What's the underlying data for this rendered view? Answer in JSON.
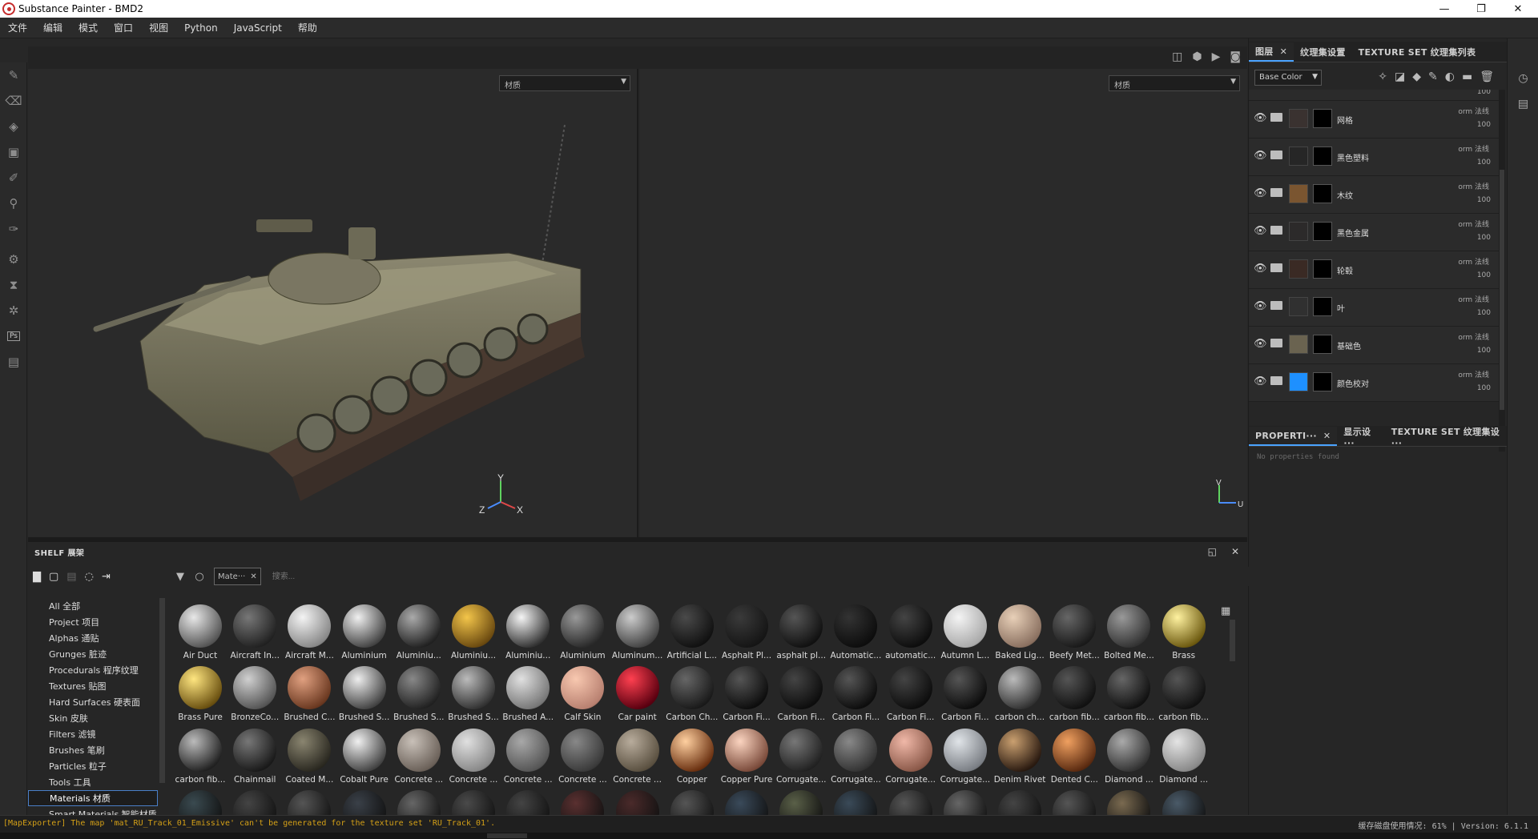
{
  "window": {
    "title": "Substance Painter - BMD2"
  },
  "menu": [
    "文件",
    "编辑",
    "模式",
    "窗口",
    "视图",
    "Python",
    "JavaScript",
    "帮助"
  ],
  "viewport": {
    "left_select": "材质",
    "right_select": "材质",
    "axis3d": {
      "x": "X",
      "y": "Y",
      "z": "Z"
    },
    "axis2d": {
      "v": "V",
      "u": "U"
    }
  },
  "right_panel": {
    "tabs_top": [
      {
        "label": "图层",
        "active": true,
        "closable": true
      },
      {
        "label": "纹理集设置",
        "active": false
      },
      {
        "label": "TEXTURE SET 纹理集列表",
        "active": false
      }
    ],
    "channel_select": "Base Color",
    "layers": [
      {
        "name": "网格",
        "blend": "orm 法线",
        "opacity": "100",
        "thumb": "#3a3230"
      },
      {
        "name": "黑色塑料",
        "blend": "orm 法线",
        "opacity": "100",
        "thumb": "#262626"
      },
      {
        "name": "木纹",
        "blend": "orm 法线",
        "opacity": "100",
        "thumb": "#7a5530"
      },
      {
        "name": "黑色金属",
        "blend": "orm 法线",
        "opacity": "100",
        "thumb": "#2c2a2a"
      },
      {
        "name": "轮毂",
        "blend": "orm 法线",
        "opacity": "100",
        "thumb": "#3a2a24"
      },
      {
        "name": "叶",
        "blend": "orm 法线",
        "opacity": "100",
        "thumb": "#303030"
      },
      {
        "name": "基础色",
        "blend": "orm 法线",
        "opacity": "100",
        "thumb": "#6a6350"
      },
      {
        "name": "颜色校对",
        "blend": "orm 法线",
        "opacity": "100",
        "thumb": "#1e90ff"
      }
    ],
    "partial_layer": {
      "name": "",
      "opacity": "100"
    },
    "tabs_bottom": [
      {
        "label": "PROPERTI···",
        "active": true,
        "closable": true
      },
      {
        "label": "显示设···",
        "active": false
      },
      {
        "label": "TEXTURE SET 纹理集设···",
        "active": false
      }
    ],
    "no_props": "No properties found"
  },
  "shelf": {
    "title": "SHELF 展架",
    "filter_chip": "Mate···",
    "search_placeholder": "搜索...",
    "categories": [
      {
        "label": "All 全部",
        "selected": false
      },
      {
        "label": "Project 项目",
        "selected": false
      },
      {
        "label": "Alphas 通贴",
        "selected": false
      },
      {
        "label": "Grunges 脏迹",
        "selected": false
      },
      {
        "label": "Procedurals 程序纹理",
        "selected": false
      },
      {
        "label": "Textures 贴图",
        "selected": false
      },
      {
        "label": "Hard Surfaces 硬表面",
        "selected": false
      },
      {
        "label": "Skin 皮肤",
        "selected": false
      },
      {
        "label": "Filters 滤镜",
        "selected": false
      },
      {
        "label": "Brushes 笔刷",
        "selected": false
      },
      {
        "label": "Particles 粒子",
        "selected": false
      },
      {
        "label": "Tools 工具",
        "selected": false
      },
      {
        "label": "Materials 材质",
        "selected": true
      },
      {
        "label": "Smart Materials 智能材质",
        "selected": false
      }
    ],
    "materials": [
      {
        "name": "Air Duct",
        "c1": "#e8e8e8",
        "c2": "#555"
      },
      {
        "name": "Aircraft In...",
        "c1": "#777",
        "c2": "#222"
      },
      {
        "name": "Aircraft M...",
        "c1": "#f4f4f4",
        "c2": "#888"
      },
      {
        "name": "Aluminium",
        "c1": "#f0f0f0",
        "c2": "#444"
      },
      {
        "name": "Aluminiu...",
        "c1": "#aaa",
        "c2": "#222"
      },
      {
        "name": "Aluminiu...",
        "c1": "#f3c54a",
        "c2": "#6b4a10"
      },
      {
        "name": "Aluminiu...",
        "c1": "#f5f5f5",
        "c2": "#333"
      },
      {
        "name": "Aluminium",
        "c1": "#999",
        "c2": "#2a2a2a"
      },
      {
        "name": "Aluminum...",
        "c1": "#ccc",
        "c2": "#444"
      },
      {
        "name": "Artificial L...",
        "c1": "#4a4a4a",
        "c2": "#111"
      },
      {
        "name": "Asphalt Pl...",
        "c1": "#3a3a3a",
        "c2": "#151515"
      },
      {
        "name": "asphalt pl...",
        "c1": "#555",
        "c2": "#111"
      },
      {
        "name": "Automatic...",
        "c1": "#333",
        "c2": "#0d0d0d"
      },
      {
        "name": "automatic...",
        "c1": "#444",
        "c2": "#0d0d0d"
      },
      {
        "name": "Autumn L...",
        "c1": "#f4f4f4",
        "c2": "#aaa"
      },
      {
        "name": "Baked Lig...",
        "c1": "#e8d0b8",
        "c2": "#8a7060"
      },
      {
        "name": "Beefy Met...",
        "c1": "#666",
        "c2": "#1a1a1a"
      },
      {
        "name": "Bolted Me...",
        "c1": "#999",
        "c2": "#333"
      },
      {
        "name": "Brass",
        "c1": "#fff2a0",
        "c2": "#6d5a10"
      },
      {
        "name": "Brass Pure",
        "c1": "#ffe680",
        "c2": "#6a5010"
      },
      {
        "name": "BronzeCo...",
        "c1": "#d0d0d0",
        "c2": "#555"
      },
      {
        "name": "Brushed C...",
        "c1": "#e0a080",
        "c2": "#6a3820"
      },
      {
        "name": "Brushed S...",
        "c1": "#eee",
        "c2": "#444"
      },
      {
        "name": "Brushed S...",
        "c1": "#888",
        "c2": "#222"
      },
      {
        "name": "Brushed S...",
        "c1": "#bbb",
        "c2": "#333"
      },
      {
        "name": "Brushed A...",
        "c1": "#e0e0e0",
        "c2": "#777"
      },
      {
        "name": "Calf Skin",
        "c1": "#f8c8b0",
        "c2": "#b88070"
      },
      {
        "name": "Car paint",
        "c1": "#ff4050",
        "c2": "#5a0010"
      },
      {
        "name": "Carbon Ch...",
        "c1": "#666",
        "c2": "#1a1a1a"
      },
      {
        "name": "Carbon Fi...",
        "c1": "#555",
        "c2": "#0d0d0d"
      },
      {
        "name": "Carbon Fi...",
        "c1": "#444",
        "c2": "#0d0d0d"
      },
      {
        "name": "Carbon Fi...",
        "c1": "#555",
        "c2": "#0d0d0d"
      },
      {
        "name": "Carbon Fi...",
        "c1": "#444",
        "c2": "#0d0d0d"
      },
      {
        "name": "Carbon Fi...",
        "c1": "#555",
        "c2": "#0d0d0d"
      },
      {
        "name": "carbon ch...",
        "c1": "#bbb",
        "c2": "#333"
      },
      {
        "name": "carbon fib...",
        "c1": "#555",
        "c2": "#111"
      },
      {
        "name": "carbon fib...",
        "c1": "#666",
        "c2": "#111"
      },
      {
        "name": "carbon fib...",
        "c1": "#555",
        "c2": "#111"
      },
      {
        "name": "carbon fib...",
        "c1": "#bbb",
        "c2": "#222"
      },
      {
        "name": "Chainmail",
        "c1": "#777",
        "c2": "#1a1a1a"
      },
      {
        "name": "Coated M...",
        "c1": "#8a8570",
        "c2": "#2a2820"
      },
      {
        "name": "Cobalt Pure",
        "c1": "#f0f0f0",
        "c2": "#444"
      },
      {
        "name": "Concrete ...",
        "c1": "#c8c0b8",
        "c2": "#6a6058"
      },
      {
        "name": "Concrete ...",
        "c1": "#e0e0e0",
        "c2": "#888"
      },
      {
        "name": "Concrete ...",
        "c1": "#a8a8a8",
        "c2": "#555"
      },
      {
        "name": "Concrete ...",
        "c1": "#888",
        "c2": "#3a3a3a"
      },
      {
        "name": "Concrete ...",
        "c1": "#b8ac9c",
        "c2": "#5a5040"
      },
      {
        "name": "Copper",
        "c1": "#ffd0a0",
        "c2": "#6a3010"
      },
      {
        "name": "Copper Pure",
        "c1": "#fbd4c0",
        "c2": "#7a4a3a"
      },
      {
        "name": "Corrugate...",
        "c1": "#777",
        "c2": "#222"
      },
      {
        "name": "Corrugate...",
        "c1": "#888",
        "c2": "#333"
      },
      {
        "name": "Corrugate...",
        "c1": "#f0b8a8",
        "c2": "#8a5848"
      },
      {
        "name": "Corrugate...",
        "c1": "#e0e4e8",
        "c2": "#7a7e84"
      },
      {
        "name": "Denim Rivet",
        "c1": "#caa070",
        "c2": "#2a1a10"
      },
      {
        "name": "Dented C...",
        "c1": "#f0a060",
        "c2": "#5a2a10"
      },
      {
        "name": "Diamond ...",
        "c1": "#aaa",
        "c2": "#333"
      },
      {
        "name": "Diamond ...",
        "c1": "#e4e4e4",
        "c2": "#888"
      }
    ],
    "next_row_colors": [
      "#3a4a50",
      "#444",
      "#555",
      "#3a4048",
      "#666",
      "#4a4a4a",
      "#444",
      "#5a3030",
      "#4a2a2a",
      "#555",
      "#3a4a5a",
      "#5a6048",
      "#3a4a58",
      "#555",
      "#666",
      "#444",
      "#555",
      "#7a6a50",
      "#4a5a68",
      "#3a3a3a"
    ]
  },
  "status": {
    "message": "[MapExporter] The map 'mat_RU_Track_01_Emissive' can't be generated for the texture set 'RU_Track_01'.",
    "right": "缓存磁盘使用情况:  61%  |  Version: 6.1.1"
  }
}
